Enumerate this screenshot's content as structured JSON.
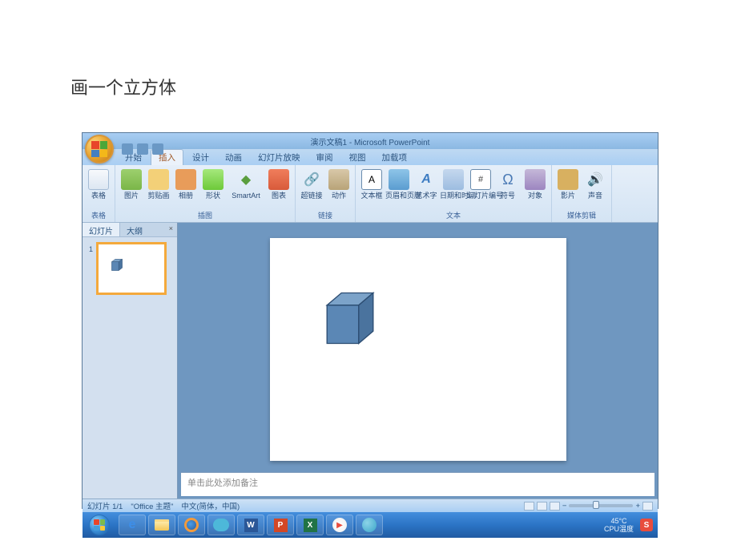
{
  "page": {
    "title": "画一个立方体"
  },
  "window": {
    "title": "演示文稿1 - Microsoft PowerPoint"
  },
  "tabs": {
    "items": [
      "开始",
      "插入",
      "设计",
      "动画",
      "幻灯片放映",
      "审阅",
      "视图",
      "加载项"
    ],
    "active_index": 1
  },
  "ribbon": {
    "groups": [
      {
        "label": "表格",
        "items": [
          {
            "label": "表格",
            "icon": "table"
          }
        ]
      },
      {
        "label": "插图",
        "items": [
          {
            "label": "图片",
            "icon": "picture"
          },
          {
            "label": "剪贴画",
            "icon": "clipart"
          },
          {
            "label": "相册",
            "icon": "album"
          },
          {
            "label": "形状",
            "icon": "shapes"
          },
          {
            "label": "SmartArt",
            "icon": "smartart"
          },
          {
            "label": "图表",
            "icon": "chart"
          }
        ]
      },
      {
        "label": "链接",
        "items": [
          {
            "label": "超链接",
            "icon": "hyperlink"
          },
          {
            "label": "动作",
            "icon": "action"
          }
        ]
      },
      {
        "label": "文本",
        "items": [
          {
            "label": "文本框",
            "icon": "textbox"
          },
          {
            "label": "页眉和页脚",
            "icon": "headerfooter"
          },
          {
            "label": "艺术字",
            "icon": "wordart"
          },
          {
            "label": "日期和时间",
            "icon": "datetime"
          },
          {
            "label": "幻灯片编号",
            "icon": "slidenum"
          },
          {
            "label": "符号",
            "icon": "symbol"
          },
          {
            "label": "对象",
            "icon": "object"
          }
        ]
      },
      {
        "label": "媒体剪辑",
        "items": [
          {
            "label": "影片",
            "icon": "movie"
          },
          {
            "label": "声音",
            "icon": "sound"
          }
        ]
      }
    ]
  },
  "outline": {
    "tabs": {
      "slides": "幻灯片",
      "outline": "大纲"
    },
    "slide_number": "1"
  },
  "notes": {
    "placeholder": "单击此处添加备注"
  },
  "status": {
    "slide_count": "幻灯片 1/1",
    "theme": "\"Office 主题\"",
    "language": "中文(简体，中国)"
  },
  "taskbar": {
    "temperature": "45°C",
    "temp_label": "CPU温度"
  },
  "cube": {
    "fill_front": "#5b87b5",
    "fill_top": "#7ca3c9",
    "fill_side": "#4a739e",
    "stroke": "#2c4d72"
  }
}
